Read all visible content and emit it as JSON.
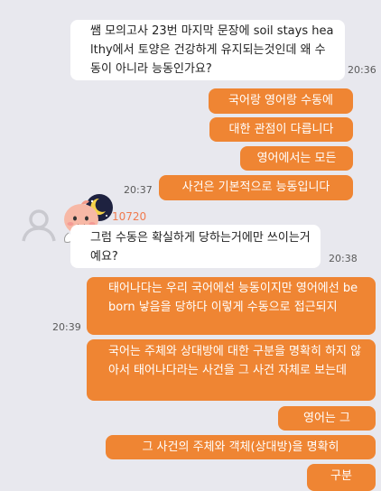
{
  "chat": {
    "m1": {
      "text": "쌤 모의고사 23번 마지막 문장에 soil stays healthy에서 토양은 건강하게 유지되는것인데 왜 수동이 아니라 능동인가요?",
      "time": "20:36"
    },
    "m2": "국어랑 영어랑 수동에",
    "m3": "대한 관점이 다릅니다",
    "m4": "영어에서는 모든",
    "m5": {
      "text": "사건은 기본적으로 능동입니다",
      "time": "20:37"
    },
    "sender_name": "10720",
    "m6": {
      "text": "그럼 수동은 확실하게 당하는거에만 쓰이는거예요?",
      "time": "20:38"
    },
    "m7": {
      "text": "태어나다는 우리 국어에선 능동이지만 영어에선 be born 낳음을 당하다 이렇게 수동으로 접근되지",
      "time": "20:39"
    },
    "m8": "국어는 주체와 상대방에 대한 구분을 명확히 하지 않아서 태어나다라는 사건을 그 사건 자체로 보는데",
    "m9": "영어는 그",
    "m10": "그 사건의 주체와 객체(상대방)을 명확히",
    "m11": "구분"
  },
  "colors": {
    "background": "#e8e8ee",
    "my_bubble": "#ef8533",
    "other_bubble": "#ffffff",
    "sender_name": "#f07a4e"
  },
  "icons": {
    "avatar": "default-profile-icon",
    "sticker": "peach-character-sticker"
  }
}
